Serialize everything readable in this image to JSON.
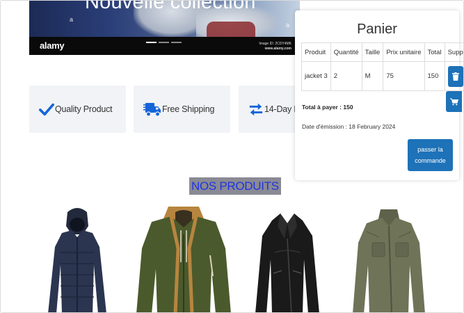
{
  "hero": {
    "title": "Nouvelle collection",
    "logo": "alamy",
    "image_id": "Image ID: 2CDY4MK",
    "url": "www.alamy.com",
    "watermark": "a"
  },
  "features": [
    {
      "label": "Quality Product",
      "icon": "checkmark-icon"
    },
    {
      "label": "Free Shipping",
      "icon": "delivery-truck-icon"
    },
    {
      "label": "14-Day Returns",
      "icon": "exchange-arrows-icon"
    }
  ],
  "section": {
    "title": "NOS PRODUITS"
  },
  "products": [
    {
      "name": "navy-puffer-jacket",
      "color": "#2b3550"
    },
    {
      "name": "olive-hooded-jacket",
      "color": "#4b5a2c"
    },
    {
      "name": "black-leather-jacket",
      "color": "#1a1a1a"
    },
    {
      "name": "khaki-field-jacket",
      "color": "#6f7358"
    }
  ],
  "cart": {
    "title": "Panier",
    "columns": [
      "Produit",
      "Quantité",
      "Taille",
      "Prix unitaire",
      "Total",
      "Supp"
    ],
    "rows": [
      {
        "product": "jacket 3",
        "quantity": "2",
        "size": "M",
        "unit_price": "75",
        "total": "150"
      }
    ],
    "total_label": "Total à payer : 150",
    "date_label": "Date d'émission : 18 February 2024",
    "order_button": "passer la commande"
  },
  "colors": {
    "accent": "#1d72b8",
    "feature_icon": "#1565d8",
    "section_title_text": "#1f34e0",
    "section_title_bg": "#8a8a94"
  }
}
